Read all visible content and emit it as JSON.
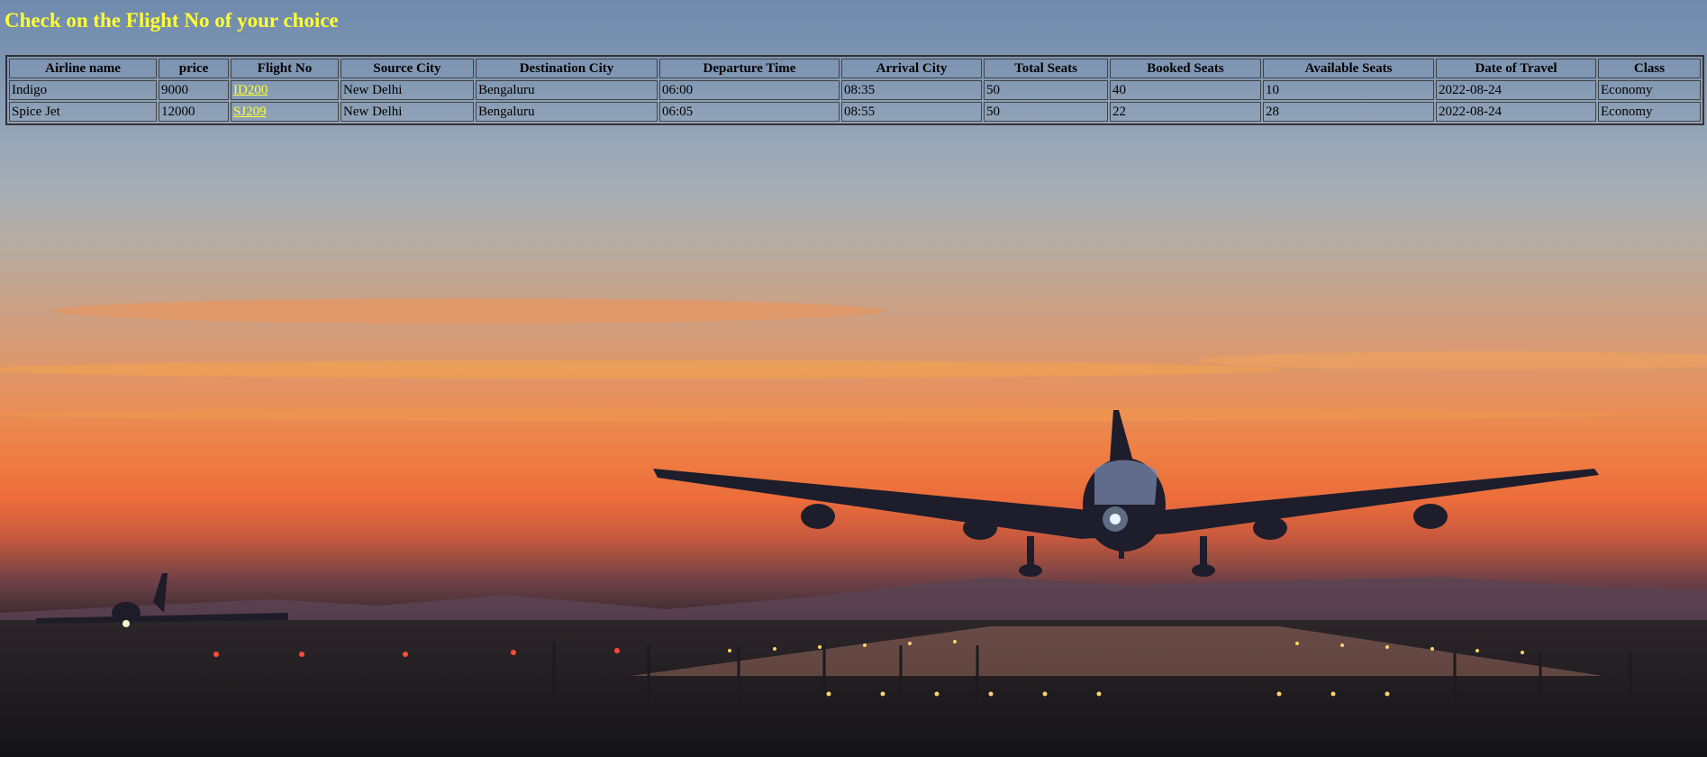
{
  "page": {
    "heading": "Check on the Flight No of your choice"
  },
  "table": {
    "headers": [
      "Airline name",
      "price",
      "Flight No",
      "Source City",
      "Destination City",
      "Departure Time",
      "Arrival City",
      "Total Seats",
      "Booked Seats",
      "Available Seats",
      "Date of Travel",
      "Class"
    ],
    "rows": [
      [
        "Indigo",
        "9000",
        "ID200",
        "New Delhi",
        "Bengaluru",
        "06:00",
        "08:35",
        "50",
        "40",
        "10",
        "2022-08-24",
        "Economy"
      ],
      [
        "Spice Jet",
        "12000",
        "SJ209",
        "New Delhi",
        "Bengaluru",
        "06:05",
        "08:55",
        "50",
        "22",
        "28",
        "2022-08-24",
        "Economy"
      ]
    ]
  },
  "colors": {
    "heading": "#ffff33",
    "link": "#ffff33"
  }
}
